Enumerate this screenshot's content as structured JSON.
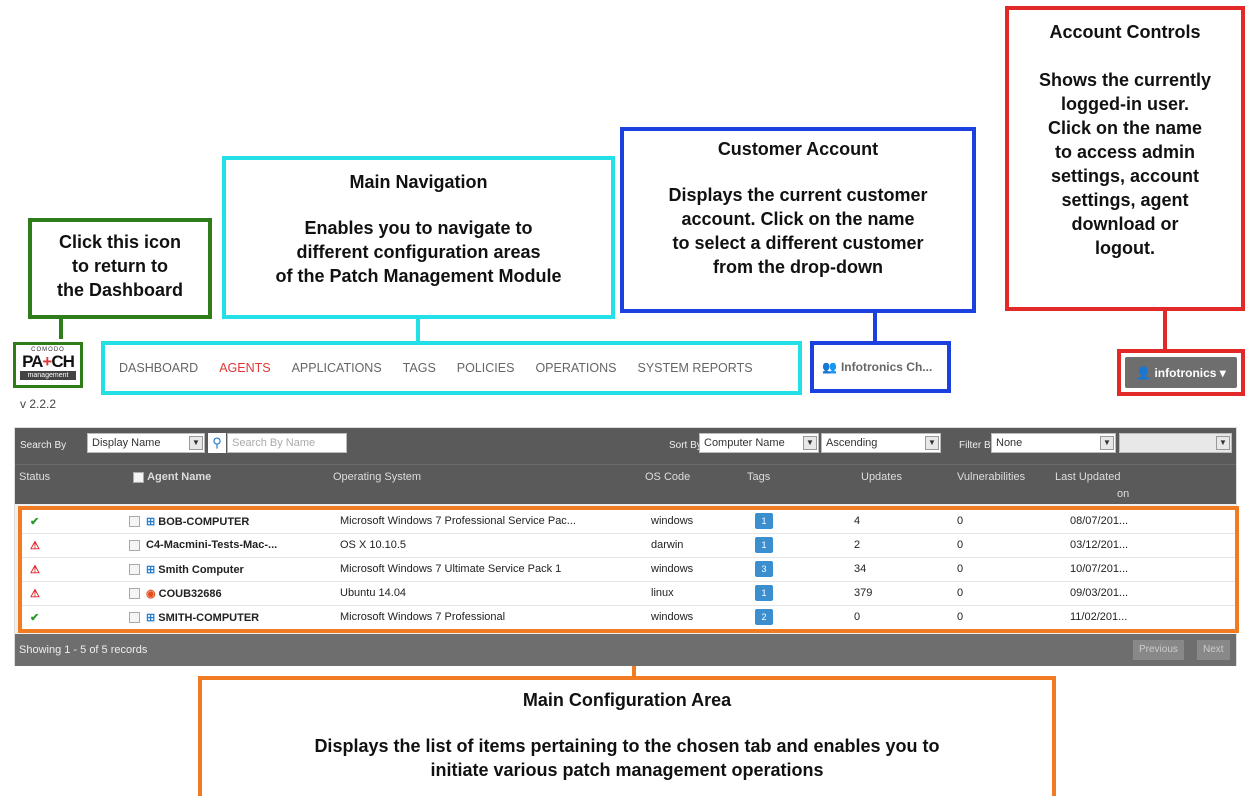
{
  "callouts": {
    "dashboard": {
      "line1": "Click this icon",
      "line2": "to return to",
      "line3": "the Dashboard"
    },
    "navigation": {
      "title": "Main Navigation",
      "line1": "Enables you to navigate to",
      "line2": "different configuration areas",
      "line3": "of the Patch Management Module"
    },
    "customer": {
      "title": "Customer Account",
      "line1": "Displays the current customer",
      "line2": "account. Click on the name",
      "line3": "to select a different customer",
      "line4": "from the drop-down"
    },
    "account": {
      "title": "Account Controls",
      "line1": "Shows the currently",
      "line2": "logged-in user.",
      "line3": "Click on the name",
      "line4": "to access admin",
      "line5": "settings, account",
      "line6": "settings, agent",
      "line7": "download or",
      "line8": "logout."
    },
    "main_area": {
      "title": "Main Configuration Area",
      "line1": "Displays the list of items pertaining to the chosen tab and enables you to",
      "line2": "initiate various patch management operations"
    }
  },
  "app": {
    "logo": {
      "top": "COMODO",
      "main_a": "PA",
      "main_b": "+",
      "main_c": "CH",
      "bottom": "management"
    },
    "version": "v 2.2.2",
    "nav": [
      "DASHBOARD",
      "AGENTS",
      "APPLICATIONS",
      "TAGS",
      "POLICIES",
      "OPERATIONS",
      "SYSTEM REPORTS"
    ],
    "active_nav": "AGENTS",
    "customer_name": "Infotronics Ch...",
    "account_name": "infotronics",
    "toolbar": {
      "search_by_label": "Search By",
      "search_by_value": "Display Name",
      "search_placeholder": "Search By Name",
      "sort_by_label": "Sort By",
      "sort_by_value": "Computer Name",
      "sort_order_value": "Ascending",
      "filter_by_label": "Filter By",
      "filter_by_value": "None"
    },
    "columns": {
      "status": "Status",
      "agent_name": "Agent Name",
      "os": "Operating System",
      "os_code": "OS Code",
      "tags": "Tags",
      "updates": "Updates",
      "vulnerabilities": "Vulnerabilities",
      "last_updated_1": "Last Updated",
      "last_updated_2": "on"
    },
    "rows": [
      {
        "status": "✔",
        "os_icon": "windows-icon",
        "name": "BOB-COMPUTER",
        "os": "Microsoft Windows 7 Professional Service Pac...",
        "os_code": "windows",
        "tags": "1",
        "updates": "4",
        "vulnerabilities": "0",
        "last_updated": "08/07/201..."
      },
      {
        "status": "⚠",
        "os_icon": "apple-icon",
        "name": "C4-Macmini-Tests-Mac-...",
        "os": "OS X 10.10.5",
        "os_code": "darwin",
        "tags": "1",
        "updates": "2",
        "vulnerabilities": "0",
        "last_updated": "03/12/201..."
      },
      {
        "status": "⚠",
        "os_icon": "windows-icon",
        "name": "Smith Computer",
        "os": "Microsoft Windows 7 Ultimate Service Pack 1",
        "os_code": "windows",
        "tags": "3",
        "updates": "34",
        "vulnerabilities": "0",
        "last_updated": "10/07/201..."
      },
      {
        "status": "⚠",
        "os_icon": "ubuntu-icon",
        "name": "COUB32686",
        "os": "Ubuntu 14.04",
        "os_code": "linux",
        "tags": "1",
        "updates": "379",
        "vulnerabilities": "0",
        "last_updated": "09/03/201..."
      },
      {
        "status": "✔",
        "os_icon": "windows-icon",
        "name": "SMITH-COMPUTER",
        "os": "Microsoft Windows 7 Professional",
        "os_code": "windows",
        "tags": "2",
        "updates": "0",
        "vulnerabilities": "0",
        "last_updated": "11/02/201..."
      }
    ],
    "footer": {
      "showing": "Showing 1 - 5 of 5 records",
      "previous": "Previous",
      "next": "Next"
    }
  }
}
